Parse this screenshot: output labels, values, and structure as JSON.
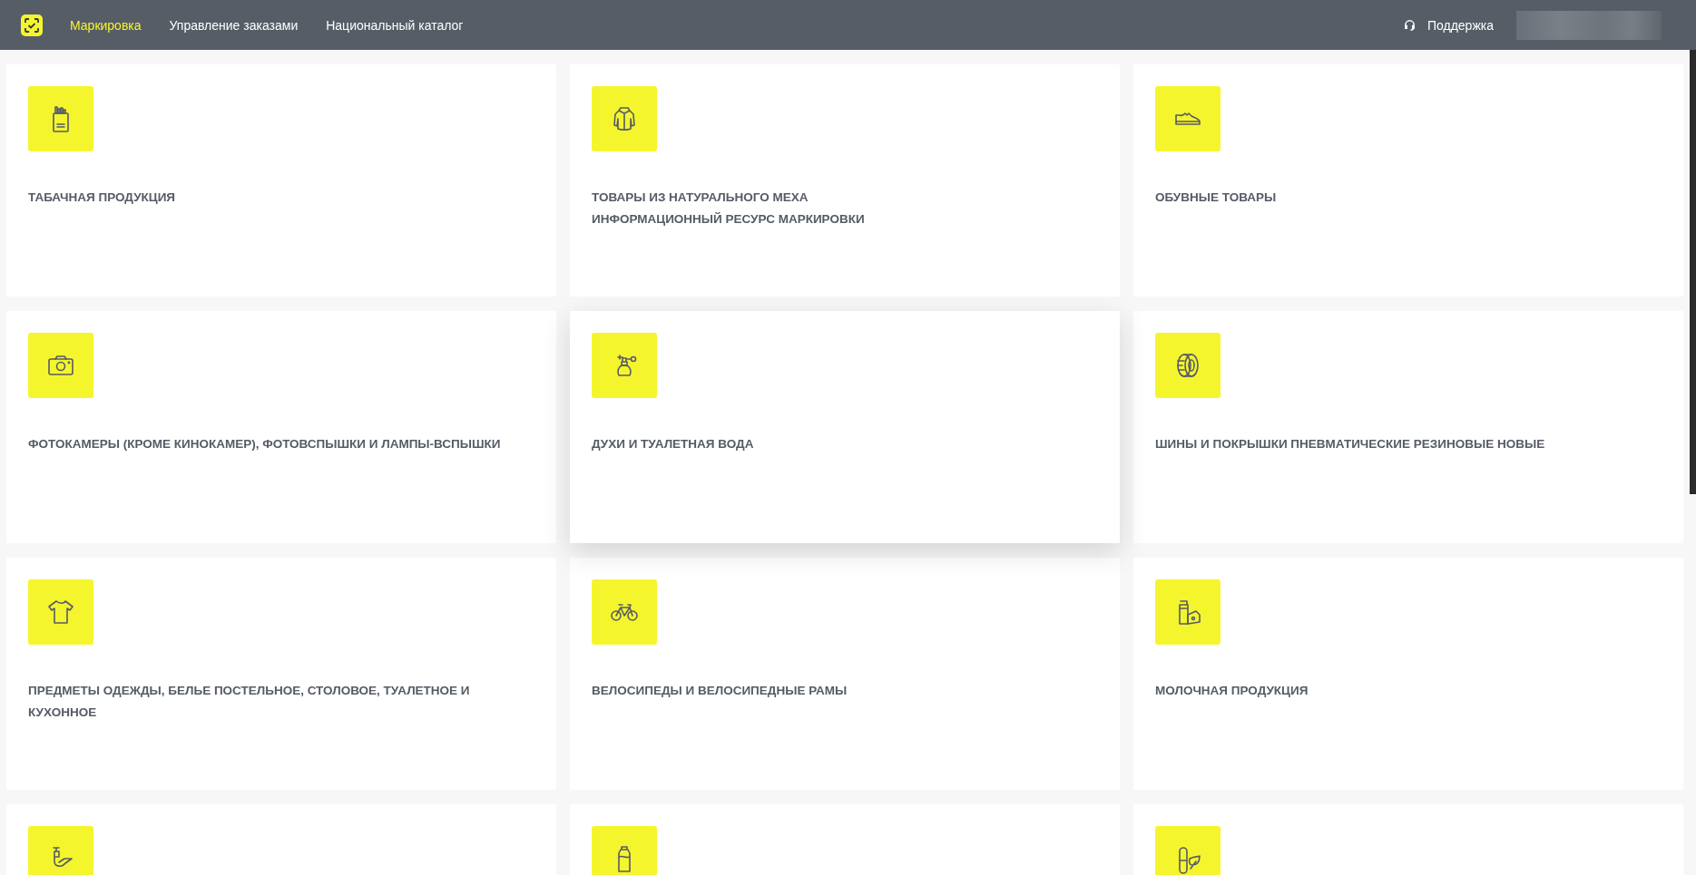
{
  "header": {
    "nav": [
      {
        "label": "Маркировка",
        "selected": true
      },
      {
        "label": "Управление заказами",
        "selected": false
      },
      {
        "label": "Национальный каталог",
        "selected": false
      }
    ],
    "support": "Поддержка"
  },
  "cards": [
    {
      "title": "ТАБАЧНАЯ ПРОДУКЦИЯ",
      "raised": false
    },
    {
      "title": "ТОВАРЫ ИЗ НАТУРАЛЬНОГО МЕХА\nИНФОРМАЦИОННЫЙ РЕСУРС МАРКИРОВКИ",
      "raised": false
    },
    {
      "title": "ОБУВНЫЕ ТОВАРЫ",
      "raised": false
    },
    {
      "title": "ФОТОКАМЕРЫ (КРОМЕ КИНОКАМЕР), ФОТОВСПЫШКИ И ЛАМПЫ-ВСПЫШКИ",
      "raised": false
    },
    {
      "title": "ДУХИ И ТУАЛЕТНАЯ ВОДА",
      "raised": true
    },
    {
      "title": "ШИНЫ И ПОКРЫШКИ ПНЕВМАТИЧЕСКИЕ РЕЗИНОВЫЕ НОВЫЕ",
      "raised": false
    },
    {
      "title": "ПРЕДМЕТЫ ОДЕЖДЫ, БЕЛЬЕ ПОСТЕЛЬНОЕ, СТОЛОВОЕ, ТУАЛЕТНОЕ И КУХОННОЕ",
      "raised": false
    },
    {
      "title": "ВЕЛОСИПЕДЫ И ВЕЛОСИПЕДНЫЕ РАМЫ",
      "raised": false
    },
    {
      "title": "МОЛОЧНАЯ ПРОДУКЦИЯ",
      "raised": false
    },
    {
      "raised": false
    },
    {
      "raised": false
    },
    {
      "raised": false
    }
  ]
}
